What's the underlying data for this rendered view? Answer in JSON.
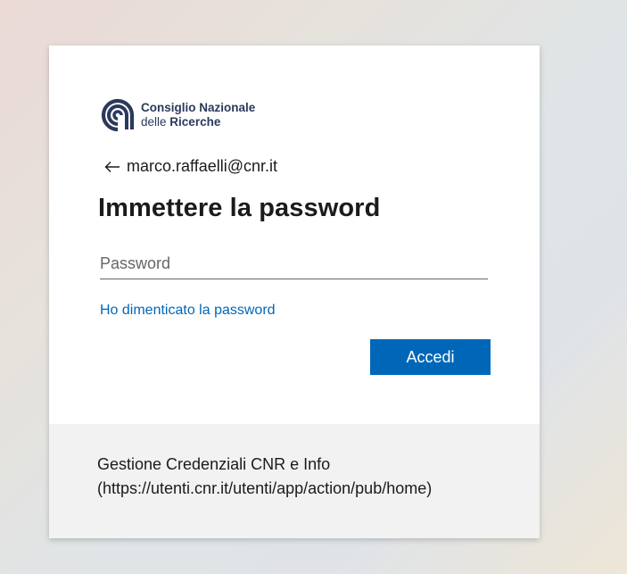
{
  "logo": {
    "line1": "Consiglio Nazionale",
    "line2_prefix": "delle",
    "line2_bold": "Ricerche",
    "color": "#2b3a5b",
    "icon": "cnr-logo-icon"
  },
  "identity": {
    "back_icon": "back-arrow-icon",
    "email": "marco.raffaelli@cnr.it"
  },
  "title": "Immettere la password",
  "password": {
    "placeholder": "Password",
    "value": ""
  },
  "forgot_link": "Ho dimenticato la password",
  "submit_label": "Accedi",
  "footer": {
    "line1": "Gestione Credenziali CNR e Info",
    "line2": "(https://utenti.cnr.it/utenti/app/action/pub/home)"
  },
  "colors": {
    "accent": "#0067b8",
    "footer_bg": "#f2f2f2",
    "text": "#1b1b1b"
  }
}
